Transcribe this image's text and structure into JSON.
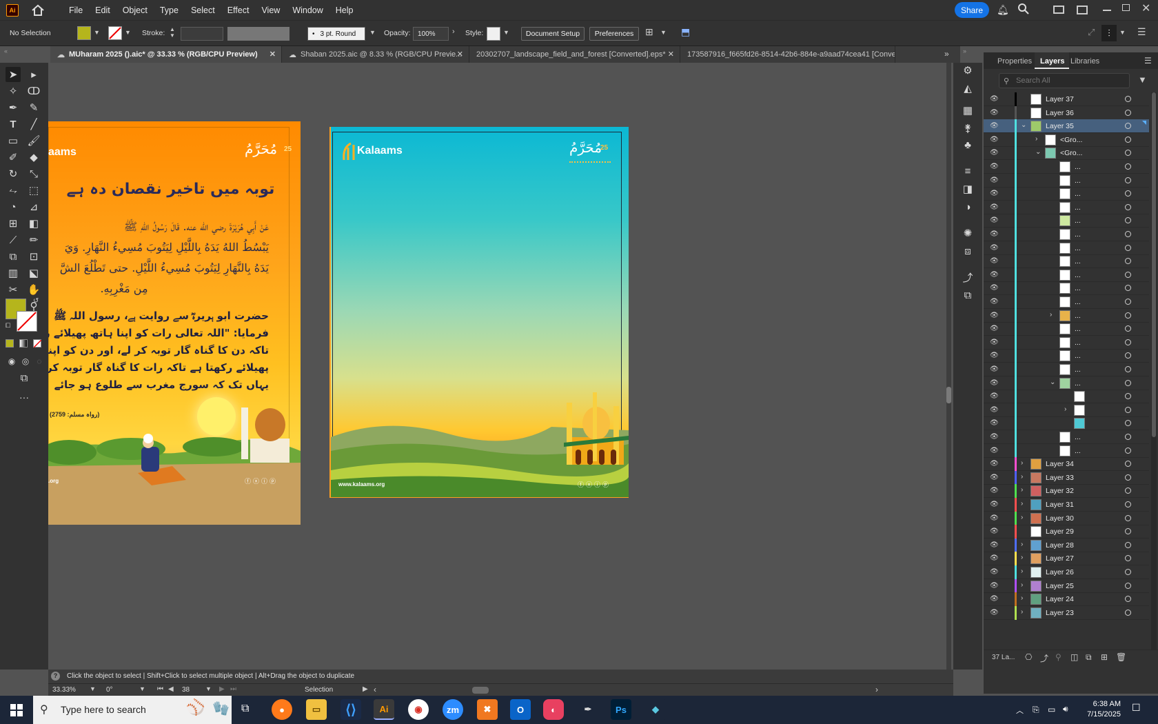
{
  "menubar": {
    "app_logo": "Ai",
    "items": [
      "File",
      "Edit",
      "Object",
      "Type",
      "Select",
      "Effect",
      "View",
      "Window",
      "Help"
    ],
    "share_label": "Share"
  },
  "control_bar": {
    "selection_status": "No Selection",
    "fill_color": "#b5b51c",
    "stroke_label": "Stroke:",
    "brush_label": "3 pt. Round",
    "opacity_label": "Opacity:",
    "opacity_value": "100%",
    "style_label": "Style:",
    "document_setup": "Document Setup",
    "preferences": "Preferences"
  },
  "tabs": [
    {
      "label": "MUharam 2025 ().aic* @ 33.33 % (RGB/CPU Preview)"
    },
    {
      "label": "Shaban 2025.aic @ 8.33 % (RGB/CPU Previe..."
    },
    {
      "label": "20302707_landscape_field_and_forest [Converted].eps*"
    },
    {
      "label": "173587916_f665fd26-8514-42b6-884e-a9aad74cea41 [Converte"
    }
  ],
  "artboard_left": {
    "brand": "aams",
    "month_logo": "مُحَرَّمُ",
    "date_num": "25",
    "title_urdu": "توبہ میں تاخیر نقصان دہ ہے",
    "arabic_line1": "عَنْ أَبِي هُرَيْرَةَ رضي الله عنه. قَالَ رَسُولُ اللهِ ﷺ",
    "arabic_line2": "يَبْسُطُ اللهُ يَدَهُ بِاللَّيْلِ لِيَتُوبَ مُسِيءُ النَّهَارِ. وَيَ",
    "arabic_line3": "يَدَهُ بِالنَّهَارِ لِيَتُوبَ مُسِيءُ اللَّيْلِ. حتى تَطْلُعَ الشَّ",
    "arabic_line4": "مِن مَغْرِبِهِ.",
    "urdu_line1": "حضرت ابو ہریرہؓ سے روایت ہے، رسول اللہ ﷺ",
    "urdu_line2": "فرمایا: \"اللہ تعالی رات کو اپنا ہاتھ پھیلائے رکھ",
    "urdu_line3": "تاکہ دن کا گناہ گار توبہ کر لے، اور دن کو اپنا",
    "urdu_line4": "پھیلائے رکھتا ہے تاکہ رات کا گناہ گار توبہ کر",
    "urdu_line5": "یہاں تک کہ سورج مغرب سے طلوع ہو جائے",
    "reference": "(رواہ مسلم: 2759)",
    "website": ".org"
  },
  "artboard_right": {
    "brand": "Kalaams",
    "month_logo": "مُحَرَّمُ",
    "date_num": "25",
    "website": "www.kalaams.org"
  },
  "panel": {
    "tabs": [
      "Properties",
      "Layers",
      "Libraries"
    ],
    "search_placeholder": "Search All",
    "footer_count": "37 La...",
    "layers": [
      {
        "name": "Layer 37",
        "color": "#000000",
        "level": 0,
        "arrow": "",
        "thumb": "#ffffff"
      },
      {
        "name": "Layer 36",
        "color": "#555555",
        "level": 0,
        "arrow": "",
        "thumb": "#ffffff"
      },
      {
        "name": "Layer 35",
        "color": "#4fe0e0",
        "level": 0,
        "arrow": "v",
        "thumb": "#9ec96a",
        "selected": true
      },
      {
        "name": "<Gro...",
        "color": "#4fe0e0",
        "level": 1,
        "arrow": ">",
        "thumb": "#ffffff"
      },
      {
        "name": "<Gro...",
        "color": "#4fe0e0",
        "level": 1,
        "arrow": "v",
        "thumb": "#7cc8b0"
      },
      {
        "name": "...",
        "color": "#4fe0e0",
        "level": 2,
        "arrow": "",
        "thumb": "#ffffff"
      },
      {
        "name": "...",
        "color": "#4fe0e0",
        "level": 2,
        "arrow": "",
        "thumb": "#ffffff"
      },
      {
        "name": "...",
        "color": "#4fe0e0",
        "level": 2,
        "arrow": "",
        "thumb": "#ffffff"
      },
      {
        "name": "...",
        "color": "#4fe0e0",
        "level": 2,
        "arrow": "",
        "thumb": "#ffffff"
      },
      {
        "name": "...",
        "color": "#4fe0e0",
        "level": 2,
        "arrow": "",
        "thumb": "#cde8a0"
      },
      {
        "name": "...",
        "color": "#4fe0e0",
        "level": 2,
        "arrow": "",
        "thumb": "#ffffff"
      },
      {
        "name": "...",
        "color": "#4fe0e0",
        "level": 2,
        "arrow": "",
        "thumb": "#ffffff"
      },
      {
        "name": "...",
        "color": "#4fe0e0",
        "level": 2,
        "arrow": "",
        "thumb": "#ffffff"
      },
      {
        "name": "...",
        "color": "#4fe0e0",
        "level": 2,
        "arrow": "",
        "thumb": "#ffffff"
      },
      {
        "name": "...",
        "color": "#4fe0e0",
        "level": 2,
        "arrow": "",
        "thumb": "#ffffff"
      },
      {
        "name": "...",
        "color": "#4fe0e0",
        "level": 2,
        "arrow": "",
        "thumb": "#ffffff"
      },
      {
        "name": "...",
        "color": "#4fe0e0",
        "level": 2,
        "arrow": ">",
        "thumb": "#e8b24a"
      },
      {
        "name": "...",
        "color": "#4fe0e0",
        "level": 2,
        "arrow": "",
        "thumb": "#ffffff"
      },
      {
        "name": "...",
        "color": "#4fe0e0",
        "level": 2,
        "arrow": "",
        "thumb": "#ffffff"
      },
      {
        "name": "...",
        "color": "#4fe0e0",
        "level": 2,
        "arrow": "",
        "thumb": "#ffffff"
      },
      {
        "name": "...",
        "color": "#4fe0e0",
        "level": 2,
        "arrow": "",
        "thumb": "#ffffff"
      },
      {
        "name": "...",
        "color": "#4fe0e0",
        "level": 2,
        "arrow": "v",
        "thumb": "#9fd3a0"
      },
      {
        "name": "",
        "color": "#4fe0e0",
        "level": 3,
        "arrow": "",
        "thumb": "#ffffff"
      },
      {
        "name": "",
        "color": "#4fe0e0",
        "level": 3,
        "arrow": ">",
        "thumb": "#ffffff"
      },
      {
        "name": "",
        "color": "#4fe0e0",
        "level": 3,
        "arrow": "",
        "thumb": "#4fc9d4"
      },
      {
        "name": "...",
        "color": "#4fe0e0",
        "level": 2,
        "arrow": "",
        "thumb": "#ffffff"
      },
      {
        "name": "...",
        "color": "#4fe0e0",
        "level": 2,
        "arrow": "",
        "thumb": "#ffffff"
      },
      {
        "name": "Layer 34",
        "color": "#ff4fd0",
        "level": 0,
        "arrow": ">",
        "thumb": "#e0a040"
      },
      {
        "name": "Layer 33",
        "color": "#4f5fff",
        "level": 0,
        "arrow": ">",
        "thumb": "#c87860"
      },
      {
        "name": "Layer 32",
        "color": "#4fe04f",
        "level": 0,
        "arrow": ">",
        "thumb": "#d06060"
      },
      {
        "name": "Layer 31",
        "color": "#ff4f4f",
        "level": 0,
        "arrow": ">",
        "thumb": "#4fa0c0"
      },
      {
        "name": "Layer 30",
        "color": "#4fe04f",
        "level": 0,
        "arrow": ">",
        "thumb": "#d07050"
      },
      {
        "name": "Layer 29",
        "color": "#ff4f4f",
        "level": 0,
        "arrow": "",
        "thumb": "#ffffff"
      },
      {
        "name": "Layer 28",
        "color": "#4f6fff",
        "level": 0,
        "arrow": ">",
        "thumb": "#60a0d0"
      },
      {
        "name": "Layer 27",
        "color": "#ffe04f",
        "level": 0,
        "arrow": ">",
        "thumb": "#e0a060"
      },
      {
        "name": "Layer 26",
        "color": "#4fe0e0",
        "level": 0,
        "arrow": ">",
        "thumb": "#e0f0f0"
      },
      {
        "name": "Layer 25",
        "color": "#b04fff",
        "level": 0,
        "arrow": ">",
        "thumb": "#b080d0"
      },
      {
        "name": "Layer 24",
        "color": "#c07020",
        "level": 0,
        "arrow": ">",
        "thumb": "#60a080"
      },
      {
        "name": "Layer 23",
        "color": "#b0e04f",
        "level": 0,
        "arrow": ">",
        "thumb": "#70b0c0"
      }
    ]
  },
  "statusbar": {
    "hint": "Click the object to select  |  Shift+Click to select multiple object  |  Alt+Drag the object to duplicate",
    "zoom": "33.33%",
    "rotation": "0°",
    "artboard_num": "38",
    "tool_name": "Selection"
  },
  "taskbar": {
    "search_placeholder": "Type here to search",
    "time": "6:38 AM",
    "date": "7/15/2025"
  }
}
